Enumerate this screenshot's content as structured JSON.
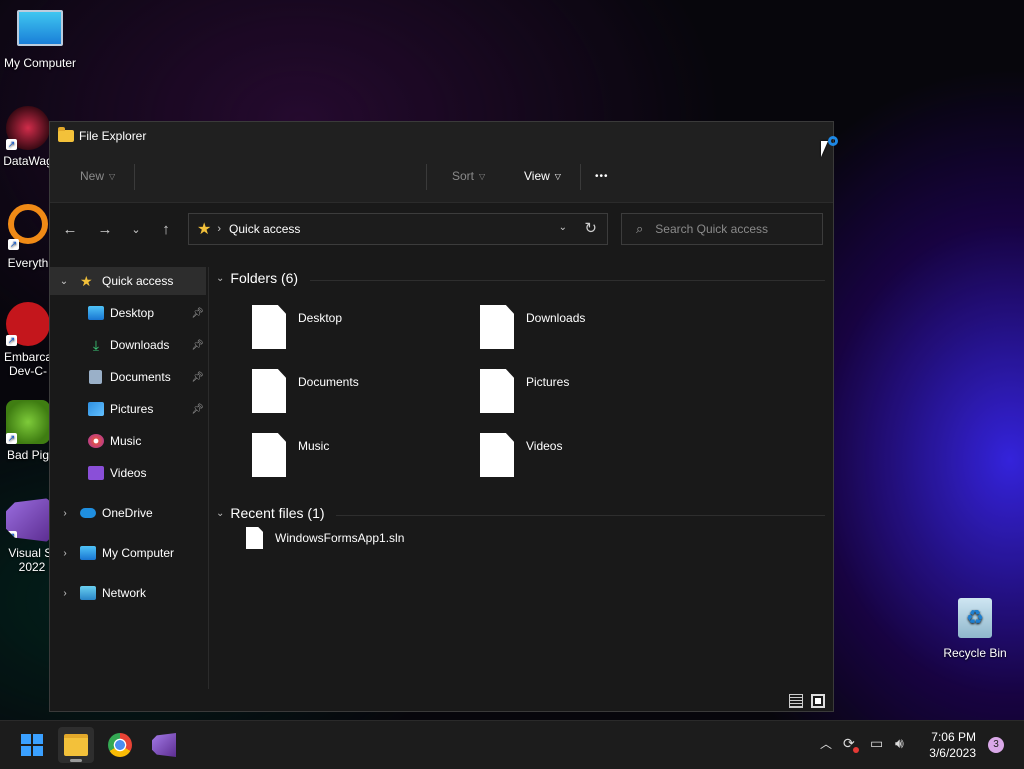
{
  "desktop": {
    "icons": [
      {
        "label": "My Computer"
      },
      {
        "label": "DataWag"
      },
      {
        "label": "Everyth"
      },
      {
        "label": "Embarca Dev-C-"
      },
      {
        "label": "Bad Pig"
      },
      {
        "label": "Visual St 2022"
      },
      {
        "label": "Recycle Bin"
      }
    ]
  },
  "window": {
    "title": "File Explorer",
    "toolbar": {
      "new_label": "New",
      "sort_label": "Sort",
      "view_label": "View",
      "more_label": "•••"
    },
    "address": {
      "location": "Quick access"
    },
    "search": {
      "placeholder": "Search Quick access"
    },
    "sidebar": {
      "quick_access": "Quick access",
      "pinned": [
        {
          "label": "Desktop"
        },
        {
          "label": "Downloads"
        },
        {
          "label": "Documents"
        },
        {
          "label": "Pictures"
        },
        {
          "label": "Music"
        },
        {
          "label": "Videos"
        }
      ],
      "onedrive": "OneDrive",
      "my_computer": "My Computer",
      "network": "Network"
    },
    "main": {
      "folders_header": "Folders (6)",
      "folders": [
        {
          "label": "Desktop"
        },
        {
          "label": "Downloads"
        },
        {
          "label": "Documents"
        },
        {
          "label": "Pictures"
        },
        {
          "label": "Music"
        },
        {
          "label": "Videos"
        }
      ],
      "recent_header": "Recent files (1)",
      "recent_files": [
        {
          "label": "WindowsFormsApp1.sln"
        }
      ]
    }
  },
  "taskbar": {
    "time": "7:06 PM",
    "date": "3/6/2023",
    "notification_count": "3"
  },
  "colors": {
    "accent": "#f3c13a",
    "window_bg": "#191919",
    "selected_bg": "#2d2d2d"
  }
}
